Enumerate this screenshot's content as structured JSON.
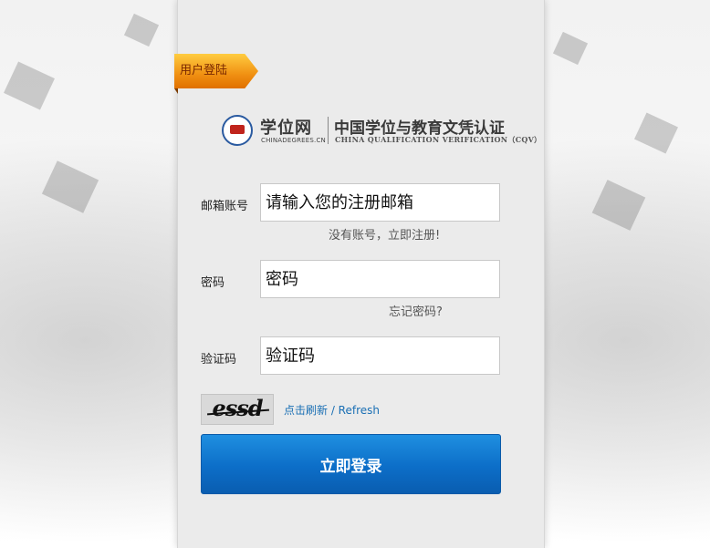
{
  "ribbon": {
    "label": "用户登陆"
  },
  "logo": {
    "name": "学位网",
    "domain": "CHINADEGREES.CN",
    "title_cn": "中国学位与教育文凭认证",
    "title_en": "CHINA QUALIFICATION VERIFICATION（CQV）"
  },
  "form": {
    "email_label": "邮箱账号",
    "email_placeholder": "请输入您的注册邮箱",
    "register_link": "没有账号，立即注册!",
    "password_label": "密码",
    "password_placeholder": "密码",
    "forgot_link": "忘记密码?",
    "captcha_label": "验证码",
    "captcha_placeholder": "验证码",
    "captcha_text": "essd",
    "refresh_link": "点击刷新 / Refresh",
    "submit_label": "立即登录"
  },
  "colors": {
    "ribbon": "#f09012",
    "button": "#0c6ec8",
    "refresh_link": "#1a6fb4"
  }
}
